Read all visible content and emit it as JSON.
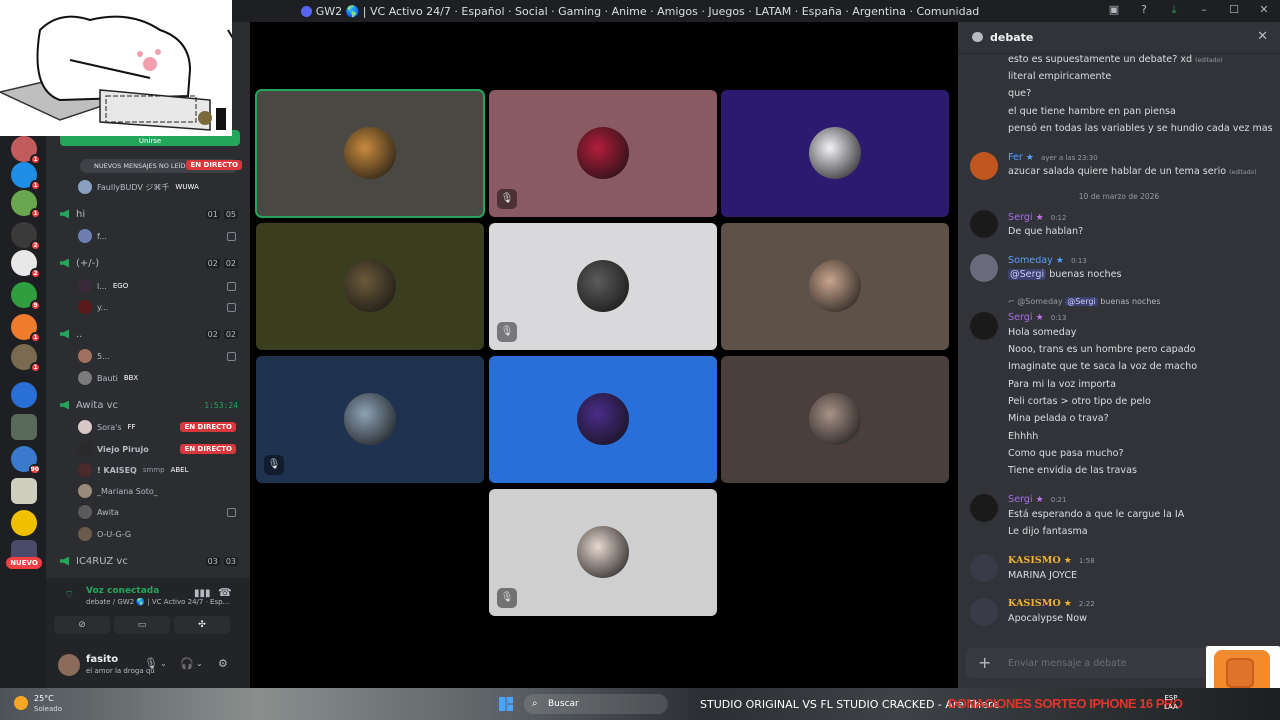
{
  "window": {
    "title": "GW2 🌎 | VC Activo 24/7 · Español · Social · Gaming · Anime · Amigos · Juegos · LATAM · España · Argentina · Comunidad"
  },
  "rail": {
    "nuevo_label": "NUEVO",
    "badges": [
      "1",
      "1",
      "1",
      "2",
      "2",
      "9",
      "1",
      "1",
      "",
      "",
      "90",
      "",
      "",
      ""
    ]
  },
  "sidebar": {
    "unread_banner": "NUEVOS MENSAJES NO LEÍDOS",
    "top_live": "EN DIRECTO",
    "green_button": "Unirse",
    "channels": [
      {
        "name": "hi",
        "count_a": "01",
        "count_b": "05"
      },
      {
        "name": "(+/-)",
        "count_a": "02",
        "count_b": "02"
      },
      {
        "name": "..",
        "count_a": "02",
        "count_b": "02"
      },
      {
        "name": "Awita vc",
        "timer": "1:53:24"
      },
      {
        "name": "IC4RUZ vc",
        "count_a": "03",
        "count_b": "03"
      }
    ],
    "users": [
      {
        "name": "FaullyBUDV ジ⌘千",
        "tag": "WUWA"
      },
      {
        "name": "f..."
      },
      {
        "name": "l...",
        "tag": "EGO"
      },
      {
        "name": "y..."
      },
      {
        "name": "5..."
      },
      {
        "name": "Bauti",
        "tag": "BBX"
      },
      {
        "name": "Sora's",
        "tag": "FF",
        "live": "EN DIRECTO"
      },
      {
        "name": "Viejo Pirujo",
        "live": "EN DIRECTO"
      },
      {
        "name": "! KAISEQ",
        "sub": "smmp",
        "tag": "ABEL"
      },
      {
        "name": "_Mariana Soto_"
      },
      {
        "name": "Awita"
      },
      {
        "name": "O-U-G-G"
      }
    ],
    "voice": {
      "status": "Voz conectada",
      "subtitle": "debate / GW2 🌎 | VC Activo 24/7 · Esp..."
    },
    "user": {
      "name": "fasito",
      "status": "el amor la droga qu"
    }
  },
  "stage": {
    "tiles": [
      {
        "bg": "#4a4843",
        "avatar": "#c98b3d",
        "speaking": true,
        "muted": false
      },
      {
        "bg": "#8a5a63",
        "avatar": "#b31d3c",
        "speaking": false,
        "muted": true
      },
      {
        "bg": "#2c1a70",
        "avatar": "#f2f2f8",
        "speaking": false,
        "muted": false
      },
      {
        "bg": "#3b3d1f",
        "avatar": "#6b5a3a",
        "speaking": false,
        "muted": false
      },
      {
        "bg": "#d9d9dc",
        "avatar": "#5c5c5c",
        "speaking": false,
        "muted": true
      },
      {
        "bg": "#5d5148",
        "avatar": "#c9a58e",
        "speaking": false,
        "muted": false
      },
      {
        "bg": "#1f3350",
        "avatar": "#8ea3b8",
        "speaking": false,
        "muted": true
      },
      {
        "bg": "#2a6ed8",
        "avatar": "#4a2c8a",
        "speaking": false,
        "muted": false
      },
      {
        "bg": "#4a3f3b",
        "avatar": "#a89288",
        "speaking": false,
        "muted": false
      },
      {
        "bg": "#cfcfcf",
        "avatar": "#e8d8d0",
        "speaking": false,
        "muted": true
      }
    ]
  },
  "chat": {
    "channel": "debate",
    "edited": "(editado)",
    "early_lines": [
      "esto es supuestamente un debate? xd",
      "literal empiricamente",
      "que?",
      "el que tiene hambre en pan piensa",
      "pensó en todas las variables y se hundio cada vez mas"
    ],
    "fer": {
      "name": "Fer",
      "time": "ayer a las 23:30",
      "text": "azucar salada quiere hablar de un tema serio"
    },
    "date_separator": "10 de marzo de 2026",
    "sergi1": {
      "name": "Sergi",
      "time": "0:12",
      "text": "De que hablan?"
    },
    "someday": {
      "name": "Someday",
      "time": "0:13",
      "mention": "@Sergi",
      "text": "buenas noches"
    },
    "reply": {
      "who": "@Someday",
      "mention": "@Sergi",
      "text": "buenas noches"
    },
    "sergi2": {
      "name": "Sergi",
      "time": "0:13",
      "lines": [
        "Hola someday",
        "Nooo, trans es un hombre pero capado",
        "Imaginate que te saca la voz de macho",
        "Para mi la voz importa",
        "Peli cortas > otro tipo de pelo",
        "Mina pelada o trava?",
        "Ehhhh",
        "Como que pasa mucho?",
        "Tiene envidia de las travas"
      ]
    },
    "sergi3": {
      "name": "Sergi",
      "time": "0:21",
      "lines": [
        "Está esperando a que le cargue la IA",
        "Le dijo fantasma"
      ]
    },
    "kasismo1": {
      "name": "KASISMO",
      "time": "1:58",
      "text": "MARINA JOYCE"
    },
    "kasismo2": {
      "name": "KASISMO",
      "time": "2:22",
      "text": "Apocalypse Now"
    },
    "input_placeholder": "Enviar mensaje a debate"
  },
  "taskbar": {
    "temp": "25°C",
    "weather": "Soleado",
    "search": "Buscar",
    "task_title": "STUDIO ORIGINAL VS FL STUDIO CRACKED - Are There",
    "ticker": "DONACIONES SORTEO IPHONE 16 PRO",
    "lang_top": "ESP",
    "lang_bottom": "LAA"
  },
  "colors": {
    "accent_green": "#23a55a",
    "live_red": "#da373c",
    "mention_blue": "#5865f2",
    "sergi_purple": "#a56ee6",
    "fer_blue": "#5aa0ff",
    "kasismo_gold": "#f0b232"
  }
}
